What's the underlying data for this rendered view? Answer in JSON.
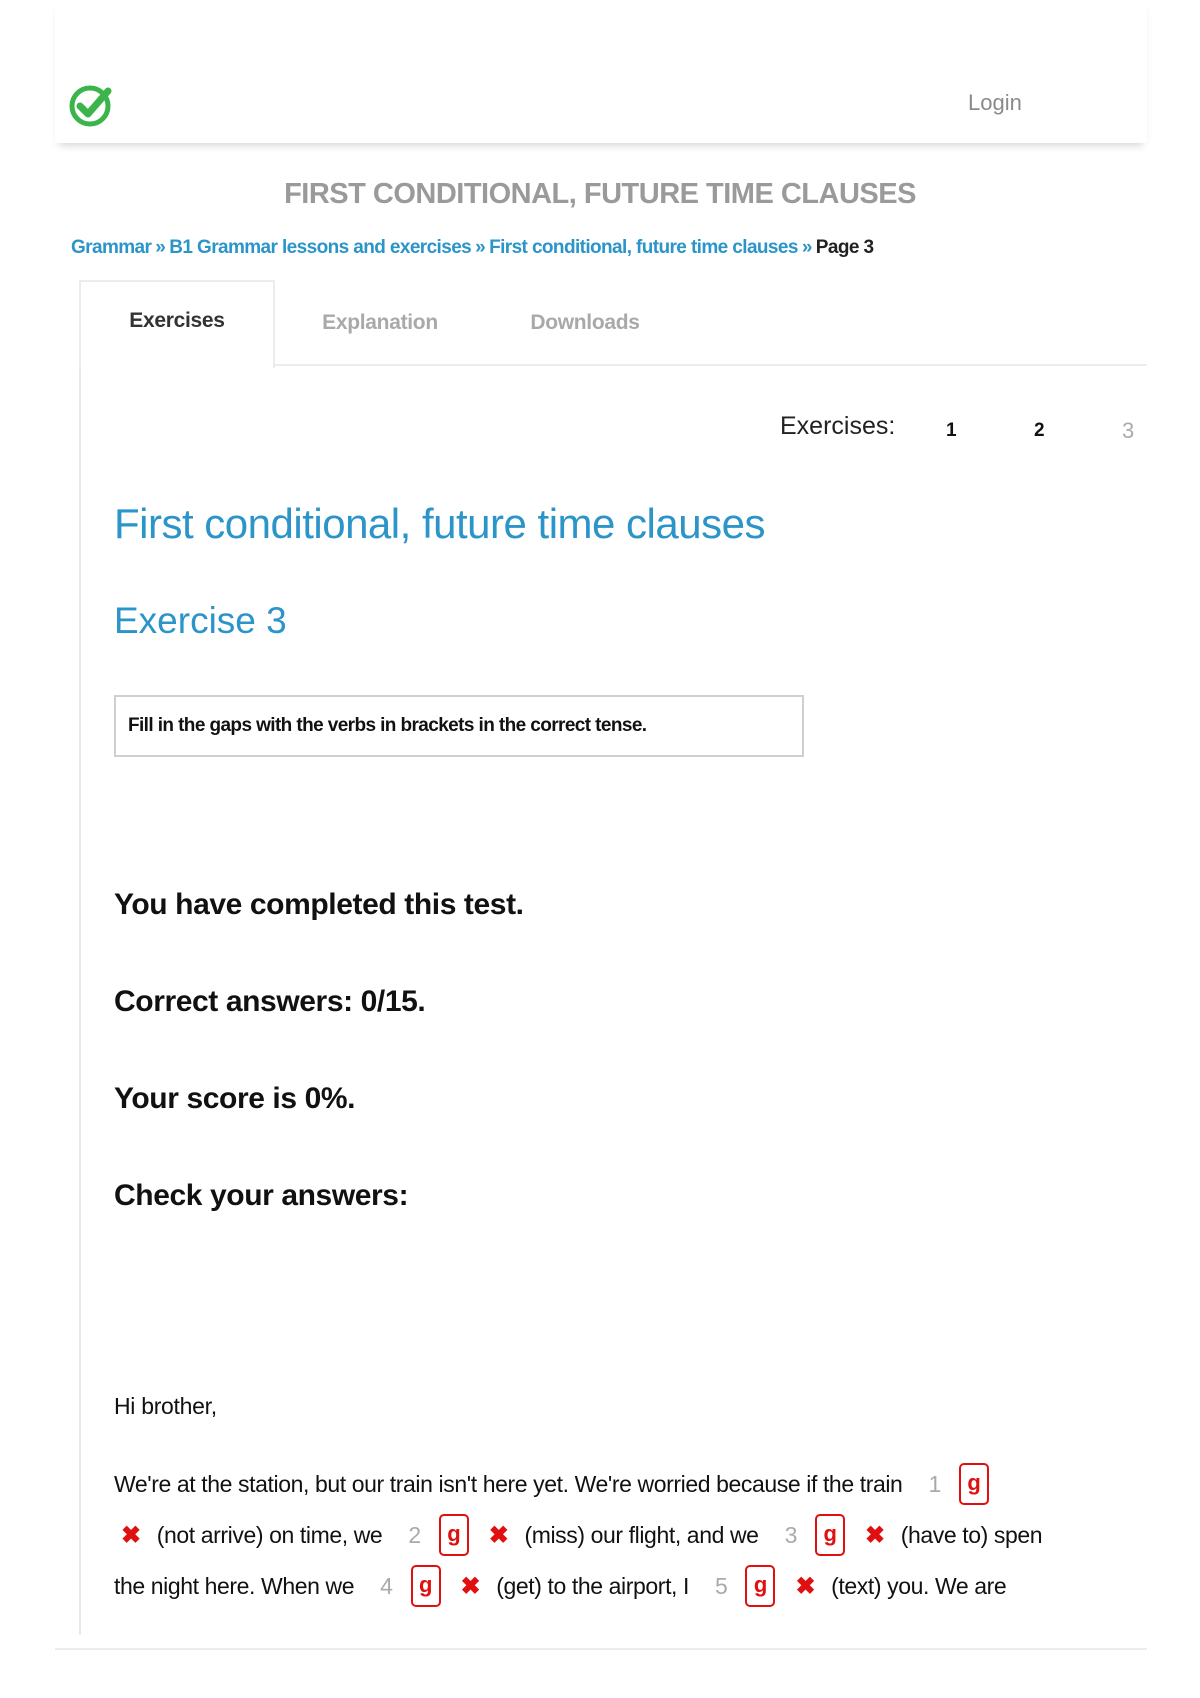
{
  "header": {
    "logo_icon": "check-circle-icon",
    "logo_color": "#3bb54a",
    "login_label": "Login"
  },
  "page_title": "FIRST CONDITIONAL, FUTURE TIME CLAUSES",
  "breadcrumb": {
    "items": [
      "Grammar",
      "B1 Grammar lessons and exercises",
      "First conditional, future time clauses"
    ],
    "separator": "»",
    "current": "Page 3"
  },
  "tabs": [
    "Exercises",
    "Explanation",
    "Downloads"
  ],
  "exercise_nav": {
    "label": "Exercises:",
    "pages": [
      "1",
      "2",
      "3"
    ],
    "current": "3"
  },
  "main": {
    "title": "First conditional, future time clauses",
    "exercise_title": "Exercise 3",
    "instruction": "Fill in the gaps with the verbs in brackets in the correct tense."
  },
  "results": {
    "completed": "You have completed this test.",
    "correct": "Correct answers: 0/15.",
    "score": "Your score is 0%.",
    "check": "Check your answers:"
  },
  "letter": {
    "greeting": "Hi brother,",
    "line1_text": "We're at the station, but our train isn't here yet. We're worried because if the train",
    "gap_letter": "g",
    "gap_mark": "✖",
    "gaps": [
      {
        "num": "1",
        "hint": "(not arrive) on time, we"
      },
      {
        "num": "2",
        "hint": "(miss) our flight, and we"
      },
      {
        "num": "3",
        "hint": "(have to) spen"
      },
      {
        "num": "4",
        "hint": "(get) to the airport, I"
      },
      {
        "num": "5",
        "hint": "(text) you. We are"
      }
    ],
    "line3_start": "the night here. When we"
  }
}
